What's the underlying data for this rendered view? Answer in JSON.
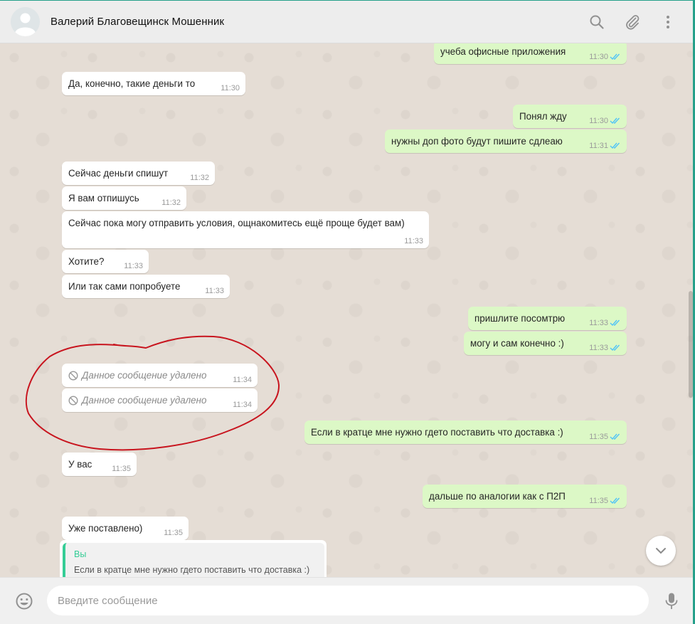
{
  "header": {
    "contact_name": "Валерий Благовещинск Мошенник",
    "icons": [
      "search-icon",
      "attach-icon",
      "menu-icon"
    ]
  },
  "messages": [
    {
      "dir": "out",
      "text": "учеба офисные приложения",
      "time": "11:30",
      "status": "read"
    },
    {
      "dir": "in",
      "text": "Да, конечно, такие деньги то",
      "time": "11:30"
    },
    {
      "dir": "out",
      "text": "Понял жду",
      "time": "11:30",
      "status": "read"
    },
    {
      "dir": "out",
      "text": "нужны доп фото будут пишите сдлеаю",
      "time": "11:31",
      "status": "read"
    },
    {
      "dir": "in",
      "text": "Сейчас деньги спишут",
      "time": "11:32"
    },
    {
      "dir": "in",
      "text": "Я вам отпишусь",
      "time": "11:32"
    },
    {
      "dir": "in",
      "text": "Сейчас пока могу отправить условия, ощнакомитесь ещё проще будет вам)",
      "time": "11:33"
    },
    {
      "dir": "in",
      "text": "Хотите?",
      "time": "11:33"
    },
    {
      "dir": "in",
      "text": "Или так сами попробуете",
      "time": "11:33"
    },
    {
      "dir": "out",
      "text": "пришлите посомтрю",
      "time": "11:33",
      "status": "read"
    },
    {
      "dir": "out",
      "text": "могу и сам конечно :)",
      "time": "11:33",
      "status": "read"
    },
    {
      "dir": "in",
      "text": "Данное сообщение удалено",
      "time": "11:34",
      "deleted": true
    },
    {
      "dir": "in",
      "text": "Данное сообщение удалено",
      "time": "11:34",
      "deleted": true
    },
    {
      "dir": "out",
      "text": "Если в кратце мне нужно гдето поставить что доставка :)",
      "time": "11:35",
      "status": "read"
    },
    {
      "dir": "in",
      "text": "У вас",
      "time": "11:35"
    },
    {
      "dir": "out",
      "text": "дальше по аналогии как с П2П",
      "time": "11:35",
      "status": "read"
    },
    {
      "dir": "in",
      "text": "Уже поставлено)",
      "time": "11:35"
    }
  ],
  "reply_quote": {
    "author": "Вы",
    "text": "Если в кратце мне нужно гдето поставить что доставка :)"
  },
  "composer": {
    "placeholder": "Введите сообщение"
  },
  "colors": {
    "incoming_bubble": "#ffffff",
    "outgoing_bubble": "#dcf8c6",
    "chat_background": "#e5ddd5",
    "read_ticks": "#4fc3f7",
    "annotation_circle": "#c8141e",
    "quote_accent": "#35cd96"
  }
}
